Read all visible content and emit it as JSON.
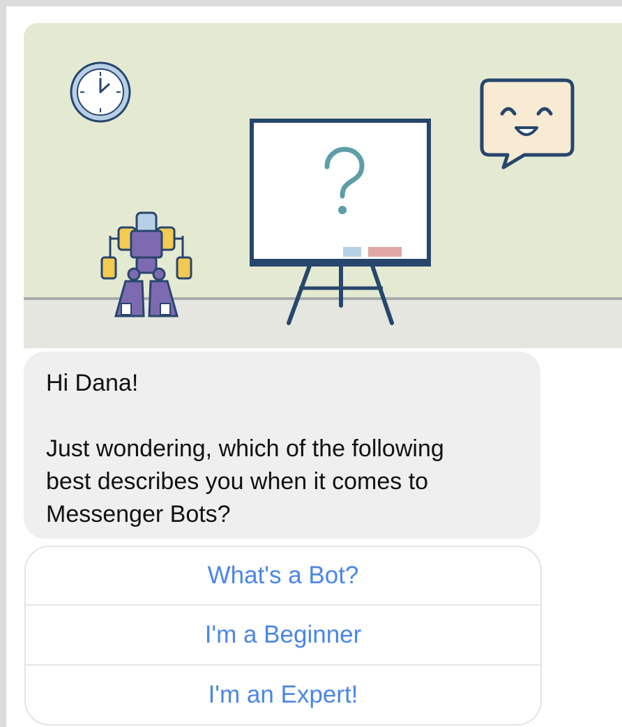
{
  "hero": {
    "icons": [
      "clock-icon",
      "whiteboard-icon",
      "question-mark-icon",
      "robot-icon",
      "smiley-speech-bubble-icon"
    ]
  },
  "message": {
    "greeting": "Hi Dana!",
    "lines": [
      "Just wondering, which of the following",
      "best describes you when it comes to",
      "Messenger Bots?"
    ]
  },
  "quick_replies": [
    {
      "label": "What's a Bot?"
    },
    {
      "label": "I'm a Beginner"
    },
    {
      "label": "I'm an Expert!"
    }
  ],
  "colors": {
    "wall": "#e4ead1",
    "floor": "#e4e6df",
    "outline": "#27466d",
    "reply_text": "#4a86e8",
    "bubble_bg": "#efefef"
  }
}
